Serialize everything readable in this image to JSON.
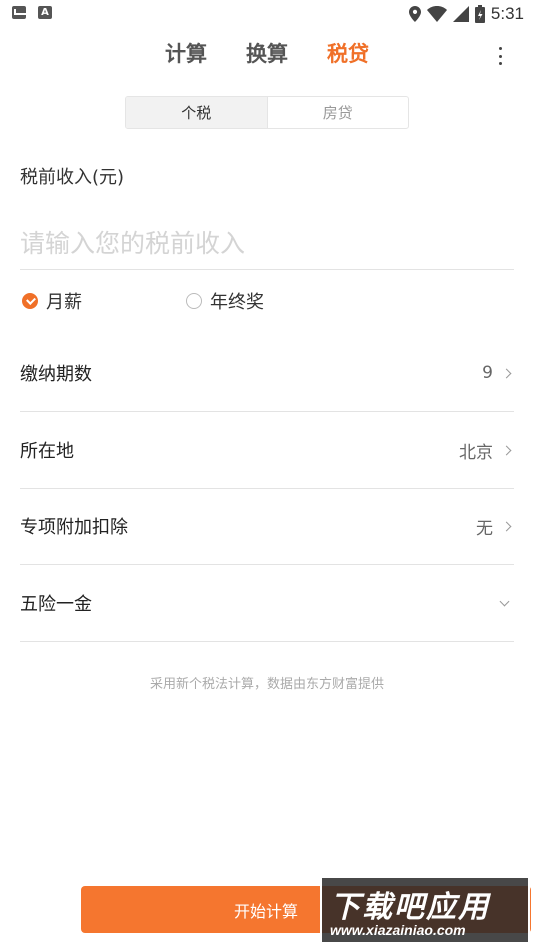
{
  "status_bar": {
    "time": "5:31",
    "font_icon_letter": "A",
    "icons": [
      "mail-icon",
      "font-icon",
      "location-icon",
      "wifi-icon",
      "signal-icon",
      "battery-icon"
    ]
  },
  "top_tabs": [
    {
      "label": "计算",
      "active": false
    },
    {
      "label": "换算",
      "active": false
    },
    {
      "label": "税贷",
      "active": true
    }
  ],
  "segment": [
    {
      "label": "个税",
      "active": true
    },
    {
      "label": "房贷",
      "active": false
    }
  ],
  "income": {
    "label": "税前收入(元)",
    "value": "",
    "placeholder": "请输入您的税前收入"
  },
  "radios": [
    {
      "label": "月薪",
      "checked": true
    },
    {
      "label": "年终奖",
      "checked": false
    }
  ],
  "rows": [
    {
      "label": "缴纳期数",
      "value": "9"
    },
    {
      "label": "所在地",
      "value": "北京"
    },
    {
      "label": "专项附加扣除",
      "value": "无"
    },
    {
      "label": "五险一金",
      "value": ""
    }
  ],
  "footnote": "采用新个税法计算，数据由东方财富提供",
  "start_button": "开始计算",
  "watermark": {
    "title": "下载吧应用",
    "url": "www.xiazainiao.com"
  },
  "colors": {
    "accent": "#f07028",
    "button": "#f5762f"
  }
}
